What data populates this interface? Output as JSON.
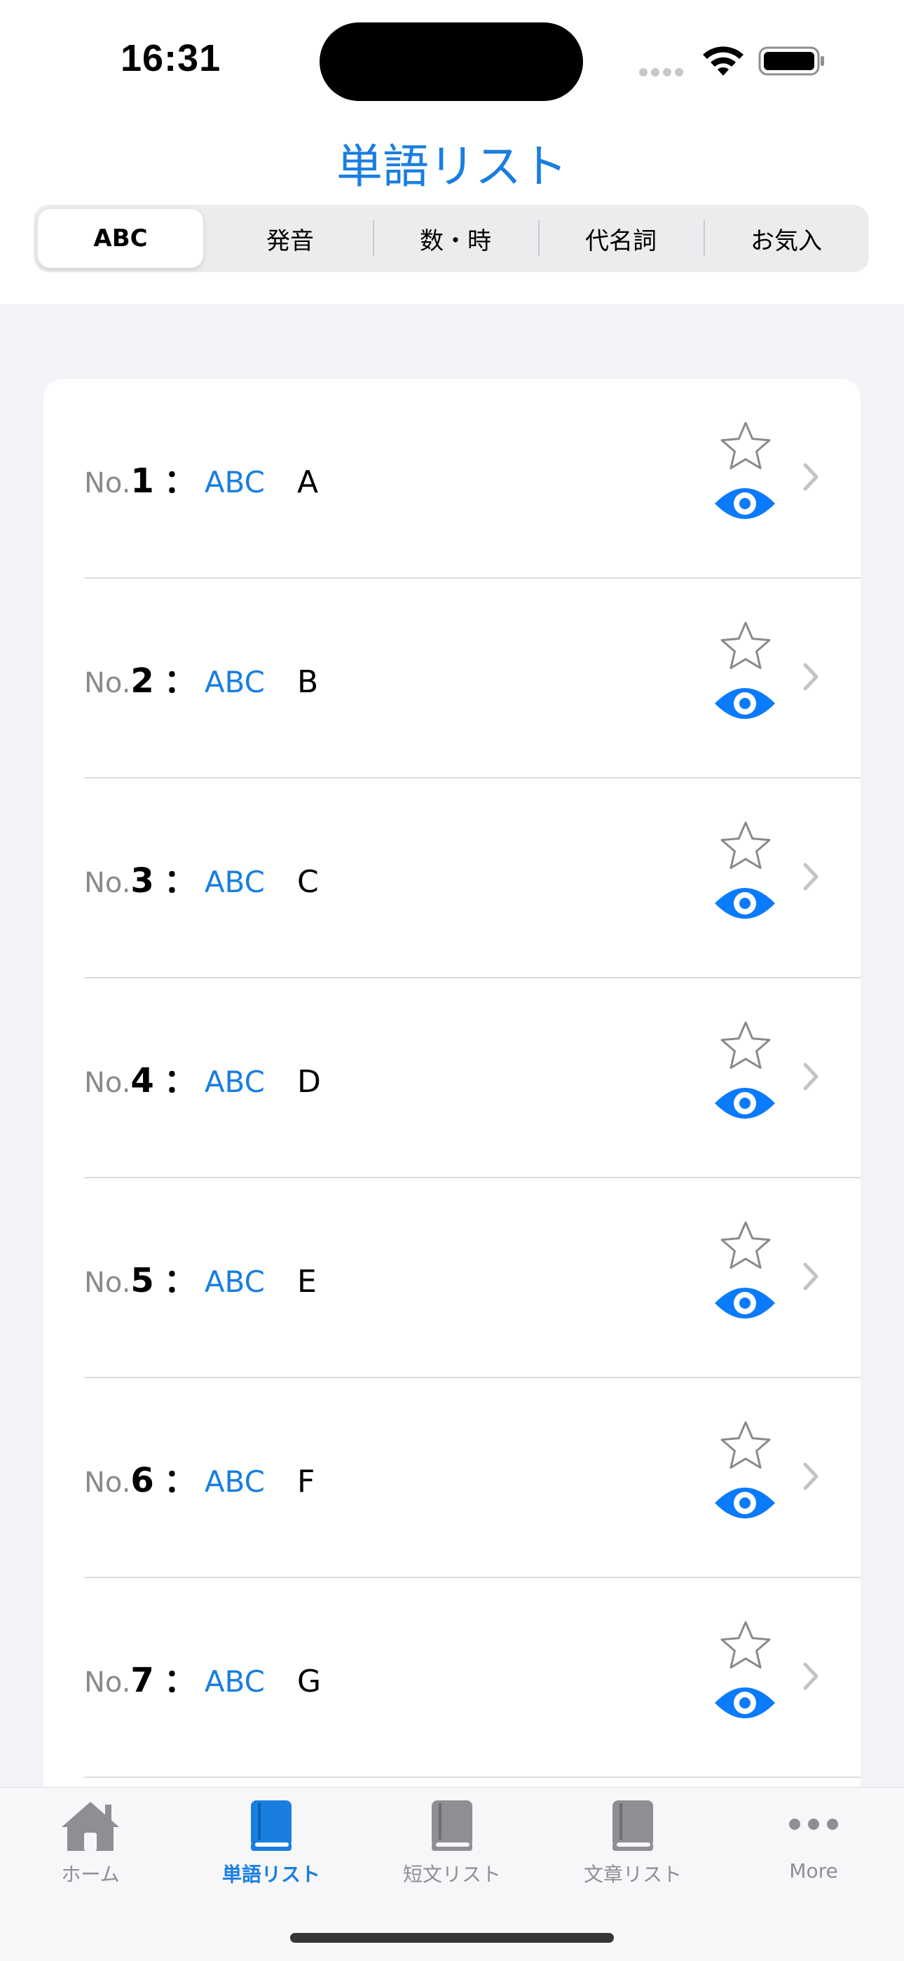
{
  "status_bar": {
    "time": "16:31"
  },
  "header": {
    "title": "単語リスト"
  },
  "segments": [
    {
      "label": "ABC",
      "selected": true
    },
    {
      "label": "発音",
      "selected": false
    },
    {
      "label": "数・時",
      "selected": false
    },
    {
      "label": "代名詞",
      "selected": false
    },
    {
      "label": "お気入",
      "selected": false
    }
  ],
  "list": {
    "no_prefix": "No.",
    "separator": "：",
    "items": [
      {
        "number": "1",
        "category": "ABC",
        "word": "A",
        "favorite": false
      },
      {
        "number": "2",
        "category": "ABC",
        "word": "B",
        "favorite": false
      },
      {
        "number": "3",
        "category": "ABC",
        "word": "C",
        "favorite": false
      },
      {
        "number": "4",
        "category": "ABC",
        "word": "D",
        "favorite": false
      },
      {
        "number": "5",
        "category": "ABC",
        "word": "E",
        "favorite": false
      },
      {
        "number": "6",
        "category": "ABC",
        "word": "F",
        "favorite": false
      },
      {
        "number": "7",
        "category": "ABC",
        "word": "G",
        "favorite": false
      }
    ]
  },
  "tabbar": {
    "items": [
      {
        "label": "ホーム",
        "icon": "house-icon",
        "active": false
      },
      {
        "label": "単語リスト",
        "icon": "book-icon",
        "active": true
      },
      {
        "label": "短文リスト",
        "icon": "book-icon",
        "active": false
      },
      {
        "label": "文章リスト",
        "icon": "book-icon",
        "active": false
      },
      {
        "label": "More",
        "icon": "ellipsis-icon",
        "active": false
      }
    ]
  },
  "colors": {
    "accent": "#1a7ee0",
    "inactive": "#8e8e93",
    "star": "#8a8a8e",
    "eye": "#0a7aff"
  }
}
